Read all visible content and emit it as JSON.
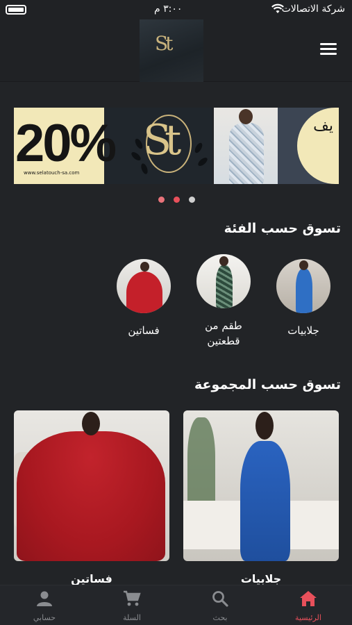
{
  "status_bar": {
    "carrier": "شركة الاتصالات",
    "time": "٣:٠٠ م"
  },
  "header": {
    "logo_icon": "st-logo"
  },
  "banner": {
    "slides": [
      {
        "discount_text": "20%",
        "url": "www.selatouch-sa.com"
      },
      {
        "text": "يف"
      }
    ],
    "page_count": 3,
    "active_page": 2
  },
  "categories": {
    "title": "تسوق حسب الفئة",
    "items": [
      {
        "label": "جلابيات"
      },
      {
        "label": "طقم من قطعتين"
      },
      {
        "label": "فساتين"
      }
    ]
  },
  "collections": {
    "title": "تسوق حسب المجموعة",
    "items": [
      {
        "label": "جلابيات"
      },
      {
        "label": "فساتين"
      }
    ]
  },
  "bottom_nav": {
    "items": [
      {
        "label": "الرئيسية",
        "icon": "home-icon",
        "active": true
      },
      {
        "label": "بحث",
        "icon": "search-icon",
        "active": false
      },
      {
        "label": "السلة",
        "icon": "cart-icon",
        "active": false
      },
      {
        "label": "حسابي",
        "icon": "account-icon",
        "active": false
      }
    ]
  },
  "colors": {
    "background": "#222427",
    "accent": "#e8505b",
    "inactive": "#8a8c90",
    "banner_cream": "#f2e8b8",
    "gold": "#d9c48a"
  }
}
